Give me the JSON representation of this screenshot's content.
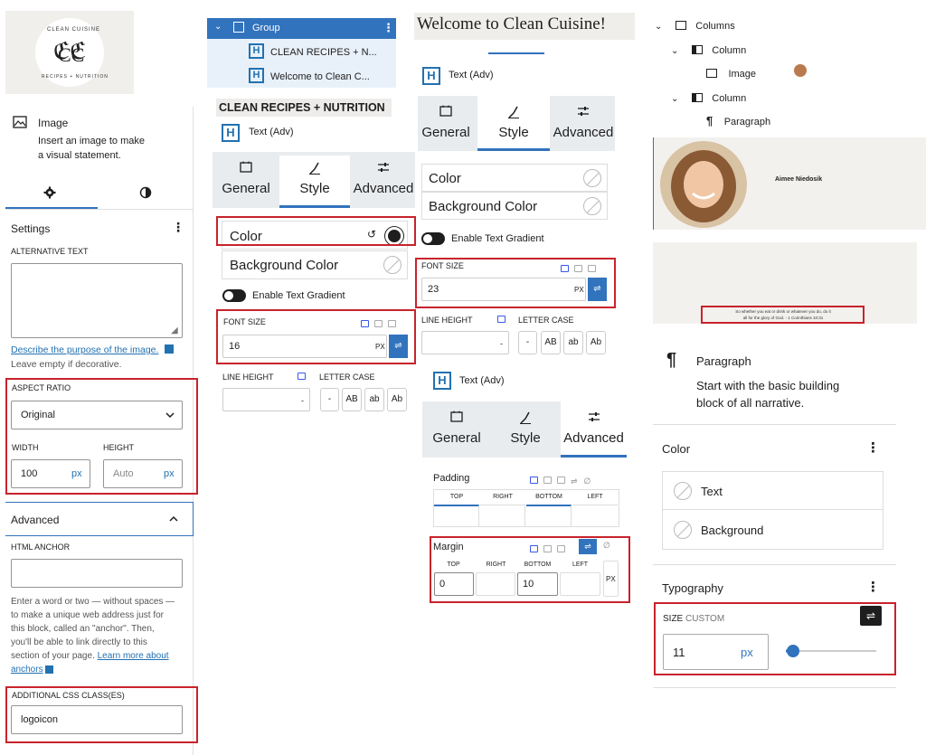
{
  "colors": {
    "accent": "#3173bd",
    "highlight_red": "#c8232c",
    "tab_bg": "#e9ecef"
  },
  "p1": {
    "logo": {
      "top_text": "CLEAN CUISINE",
      "bottom_text": "RECIPES + NUTRITION",
      "monogram": "CC"
    },
    "block": {
      "title": "Image",
      "desc_line1": "Insert an image to make",
      "desc_line2": "a visual statement."
    },
    "settings_label": "Settings",
    "alt_text_label": "ALTERNATIVE TEXT",
    "alt_value": "",
    "describe_link": "Describe the purpose of the image.",
    "leave_empty": "Leave empty if decorative.",
    "aspect_label": "ASPECT RATIO",
    "aspect_value": "Original",
    "width_label": "WIDTH",
    "height_label": "HEIGHT",
    "width_value": "100",
    "height_placeholder": "Auto",
    "unit_px": "px",
    "advanced_label": "Advanced",
    "html_anchor_label": "HTML ANCHOR",
    "anchor_value": "",
    "anchor_help_1": "Enter a word or two — without spaces —",
    "anchor_help_2": "to make a unique web address just for",
    "anchor_help_3": "this block, called an \"anchor\". Then,",
    "anchor_help_4": "you'll be able to link directly to this",
    "anchor_help_5": "section of your page.",
    "learn_more_1": "Learn more about",
    "learn_more_2": "anchors",
    "css_class_label": "ADDITIONAL CSS CLASS(ES)",
    "css_class_value": "logoicon"
  },
  "p2": {
    "group_label": "Group",
    "child1": "CLEAN RECIPES + N...",
    "child2": "Welcome to Clean C...",
    "heading": "CLEAN RECIPES + NUTRITION",
    "block_label": "Text (Adv)",
    "tabs": [
      "General",
      "Style",
      "Advanced"
    ],
    "color_label": "Color",
    "bg_color_label": "Background Color",
    "gradient_label": "Enable Text Gradient",
    "font_size_label": "FONT SIZE",
    "font_size_value": "16",
    "unit_px": "PX",
    "line_height_label": "LINE HEIGHT",
    "letter_case_label": "LETTER CASE",
    "line_height_value": "",
    "letter_case": [
      "-",
      "AB",
      "ab",
      "Ab"
    ]
  },
  "p3": {
    "heading": "Welcome to Clean Cuisine!",
    "block_label": "Text (Adv)",
    "tabs": [
      "General",
      "Style",
      "Advanced"
    ],
    "color_label": "Color",
    "bg_color_label": "Background Color",
    "gradient_label": "Enable Text Gradient",
    "font_size_label": "FONT SIZE",
    "font_size_value": "23",
    "unit_px": "PX",
    "line_height_label": "LINE HEIGHT",
    "letter_case_label": "LETTER CASE",
    "line_height_value": "",
    "letter_case": [
      "-",
      "AB",
      "ab",
      "Ab"
    ],
    "block_label_2": "Text (Adv)",
    "tabs_2": [
      "General",
      "Style",
      "Advanced"
    ],
    "padding_label": "Padding",
    "sides": [
      "TOP",
      "RIGHT",
      "BOTTOM",
      "LEFT"
    ],
    "margin_label": "Margin",
    "margin_top": "0",
    "margin_bottom": "10",
    "margin_unit": "PX"
  },
  "p4": {
    "tree": {
      "columns": "Columns",
      "column1": "Column",
      "image": "Image",
      "column2": "Column",
      "paragraph": "Paragraph"
    },
    "name": "Aimee Niedosik",
    "quote_line1": "So whether you eat or drink or whatever you do, do it",
    "quote_line2": "all for the glory of God. - 1 Corinthians 10:31",
    "block": {
      "title": "Paragraph",
      "desc_line1": "Start with the basic building",
      "desc_line2": "block of all narrative."
    },
    "color_label": "Color",
    "text_label": "Text",
    "background_label": "Background",
    "typography_label": "Typography",
    "size_label": "SIZE",
    "size_mode": "CUSTOM",
    "size_value": "11",
    "size_unit": "px",
    "size_slider_fraction": 0.08
  }
}
